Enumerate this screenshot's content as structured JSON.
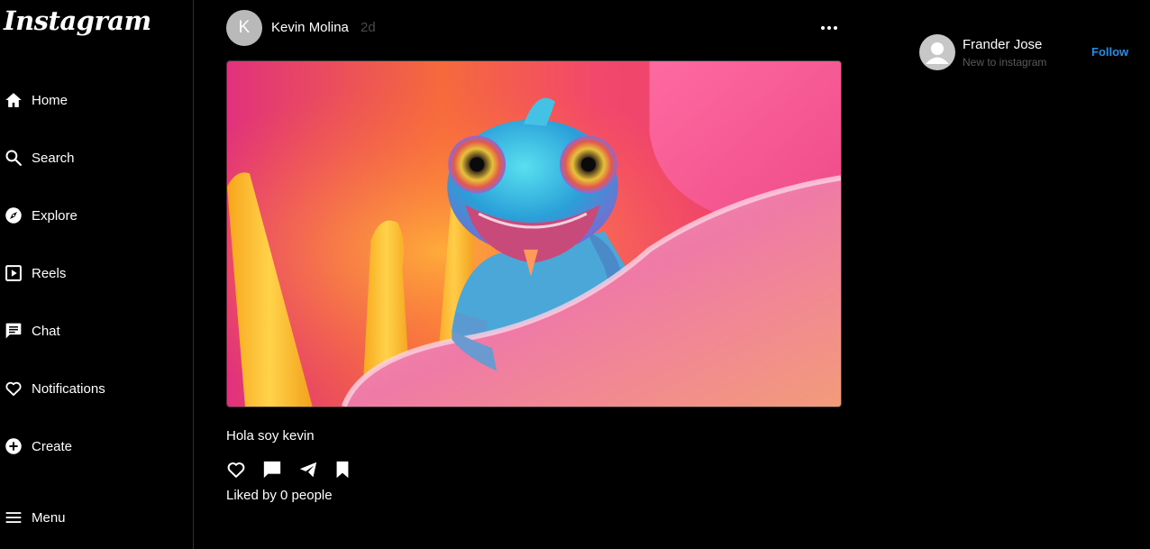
{
  "app": {
    "logo_text": "Instagram"
  },
  "sidebar": {
    "items": [
      {
        "label": "Home",
        "icon": "home-icon"
      },
      {
        "label": "Search",
        "icon": "search-icon"
      },
      {
        "label": "Explore",
        "icon": "compass-icon"
      },
      {
        "label": "Reels",
        "icon": "reels-icon"
      },
      {
        "label": "Chat",
        "icon": "chat-icon"
      },
      {
        "label": "Notifications",
        "icon": "heart-icon"
      },
      {
        "label": "Create",
        "icon": "plus-circle-icon"
      },
      {
        "label": "Menu",
        "icon": "hamburger-icon"
      }
    ]
  },
  "post": {
    "avatar_initial": "K",
    "username": "Kevin Molina",
    "time": "2d",
    "image_alt": "chameleon-on-flower-photo",
    "caption": "Hola soy kevin",
    "likes_text": "Liked by 0 people",
    "actions": [
      "heart-icon",
      "comment-icon",
      "share-icon",
      "bookmark-icon"
    ]
  },
  "suggestion": {
    "name": "Frander Jose",
    "subtitle": "New to instagram",
    "follow_label": "Follow"
  },
  "colors": {
    "background": "#000000",
    "follow": "#1f8fe8",
    "muted": "#5a5a5a"
  }
}
